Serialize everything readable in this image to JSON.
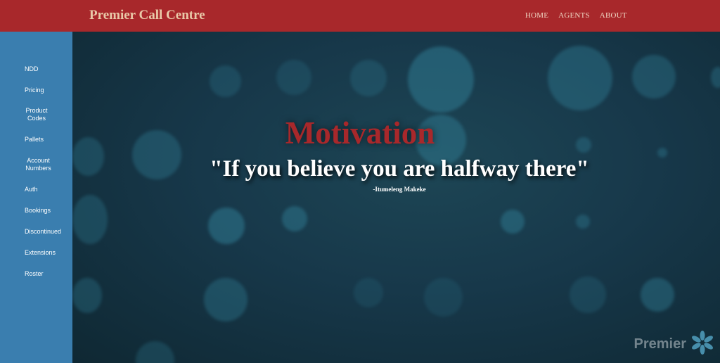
{
  "header": {
    "brand": "Premier Call Centre",
    "nav": [
      "HOME",
      "AGENTS",
      "ABOUT"
    ]
  },
  "sidebar": {
    "items": [
      {
        "label": "NDD"
      },
      {
        "label": "Pricing"
      },
      {
        "label": "Product Codes"
      },
      {
        "label": "Pallets"
      },
      {
        "label": "Account Numbers"
      },
      {
        "label": "Auth"
      },
      {
        "label": "Bookings"
      },
      {
        "label": "Discontinued"
      },
      {
        "label": "Extensions"
      },
      {
        "label": "Roster"
      }
    ]
  },
  "hero": {
    "title": "Motivation",
    "quote": "\"If you believe you are halfway there\"",
    "author": "-Itumeleng Makeke"
  },
  "watermark": {
    "text": "Premier",
    "icon": "snowflake-logo-icon"
  },
  "colors": {
    "header": "#a8282b",
    "sidebar": "#3a7eaf",
    "background": "#17343f",
    "accent": "#a8282b"
  }
}
